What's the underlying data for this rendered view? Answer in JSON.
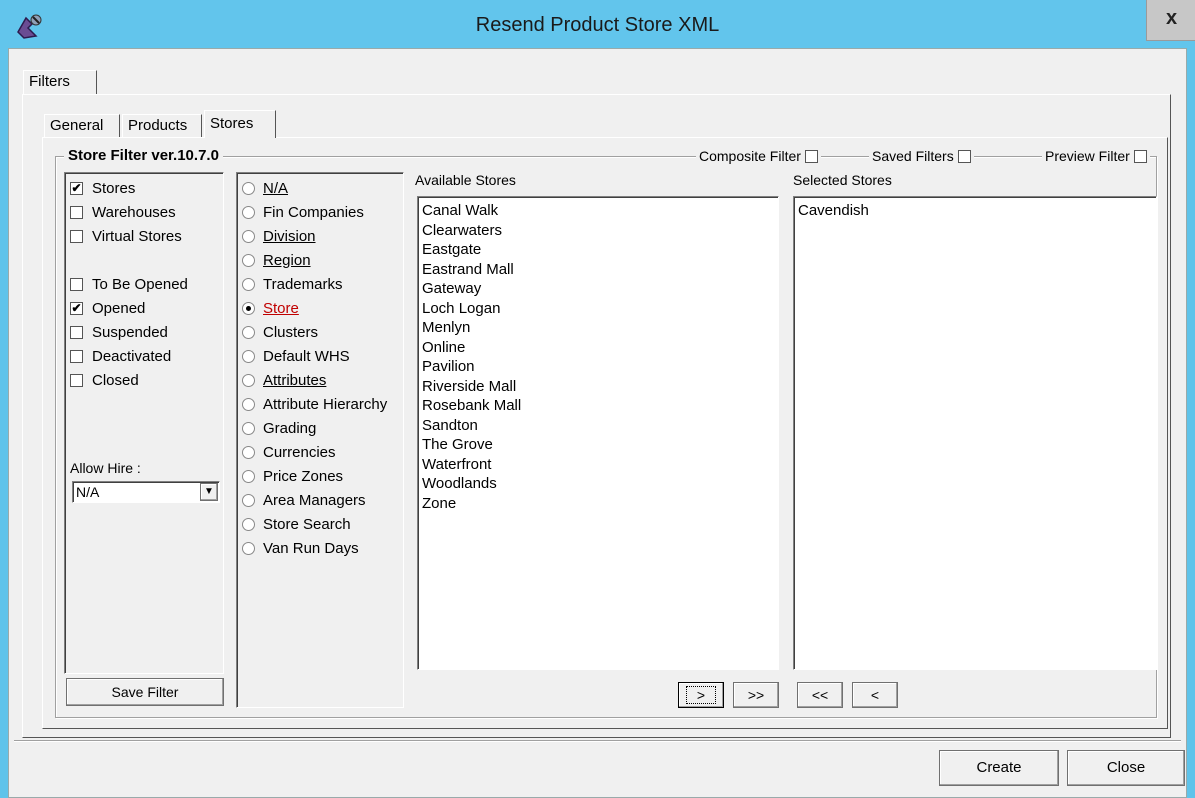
{
  "window": {
    "title": "Resend Product Store XML"
  },
  "outer_tab": "Filters",
  "tabs": [
    {
      "label": "General"
    },
    {
      "label": "Products"
    },
    {
      "label": "Stores"
    }
  ],
  "filter": {
    "group_title": "Store Filter ver.10.7.0",
    "composite_label": "Composite Filter",
    "saved_label": "Saved Filters",
    "preview_label": "Preview Filter"
  },
  "store_types": [
    {
      "label": "Stores",
      "checked": true
    },
    {
      "label": "Warehouses",
      "checked": false
    },
    {
      "label": "Virtual Stores",
      "checked": false
    }
  ],
  "store_status": [
    {
      "label": "To Be Opened",
      "checked": false
    },
    {
      "label": "Opened",
      "checked": true
    },
    {
      "label": "Suspended",
      "checked": false
    },
    {
      "label": "Deactivated",
      "checked": false
    },
    {
      "label": "Closed",
      "checked": false
    }
  ],
  "allow_hire": {
    "label": "Allow Hire :",
    "value": "N/A"
  },
  "save_filter_label": "Save Filter",
  "criteria": [
    {
      "label": "N/A",
      "selected": false
    },
    {
      "label": "Fin Companies",
      "selected": false
    },
    {
      "label": "Division",
      "selected": false
    },
    {
      "label": "Region",
      "selected": false
    },
    {
      "label": "Trademarks",
      "selected": false
    },
    {
      "label": "Store",
      "selected": true
    },
    {
      "label": "Clusters",
      "selected": false
    },
    {
      "label": "Default WHS",
      "selected": false
    },
    {
      "label": "Attributes",
      "selected": false
    },
    {
      "label": "Attribute Hierarchy",
      "selected": false
    },
    {
      "label": "Grading",
      "selected": false
    },
    {
      "label": "Currencies",
      "selected": false
    },
    {
      "label": "Price Zones",
      "selected": false
    },
    {
      "label": "Area Managers",
      "selected": false
    },
    {
      "label": "Store Search",
      "selected": false
    },
    {
      "label": "Van Run Days",
      "selected": false
    }
  ],
  "available_stores": {
    "label": "Available Stores",
    "items": [
      "Canal Walk",
      "Clearwaters",
      "Eastgate",
      "Eastrand Mall",
      "Gateway",
      "Loch Logan",
      "Menlyn",
      "Online",
      "Pavilion",
      "Riverside Mall",
      "Rosebank Mall",
      "Sandton",
      "The Grove",
      "Waterfront",
      "Woodlands",
      "Zone"
    ]
  },
  "selected_stores": {
    "label": "Selected Stores",
    "items": [
      "Cavendish"
    ]
  },
  "move_buttons": {
    "add_one": ">",
    "add_all": ">>",
    "remove_all": "<<",
    "remove_one": "<"
  },
  "footer": {
    "create_label": "Create",
    "close_label": "Close"
  },
  "colors": {
    "titlebar": "#62c5ec",
    "selected_radio_text": "#c00000"
  }
}
